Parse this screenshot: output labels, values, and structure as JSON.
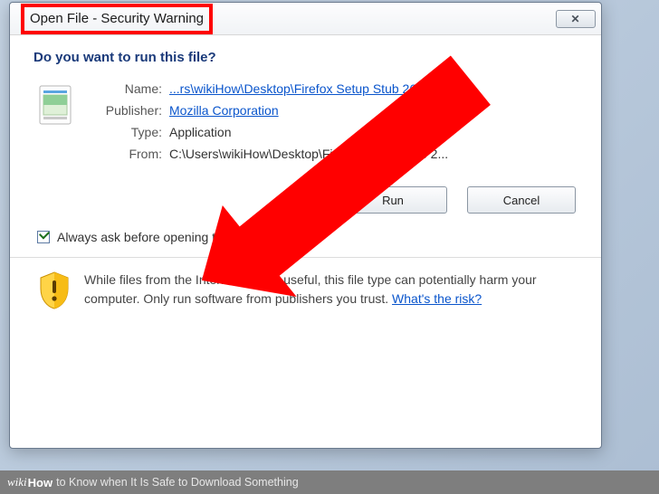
{
  "dialog": {
    "title": "Open File - Security Warning",
    "question": "Do you want to run this file?",
    "close_glyph": "✕",
    "fields": {
      "name_label": "Name:",
      "name_value": "...rs\\wikiHow\\Desktop\\Firefox Setup Stub 26.0.exe",
      "publisher_label": "Publisher:",
      "publisher_value": "Mozilla Corporation",
      "type_label": "Type:",
      "type_value": "Application",
      "from_label": "From:",
      "from_value": "C:\\Users\\wikiHow\\Desktop\\Firefox Setup Stub 2..."
    },
    "buttons": {
      "run": "Run",
      "cancel": "Cancel"
    },
    "checkbox_label": "Always ask before opening this file",
    "warning": {
      "text": "While files from the Internet can be useful, this file type can potentially harm your computer. Only run software from publishers you trust. ",
      "link": "What's the risk?"
    }
  },
  "caption": {
    "wiki": "wiki",
    "how": "How ",
    "article": "to Know when It Is Safe to Download Something"
  }
}
